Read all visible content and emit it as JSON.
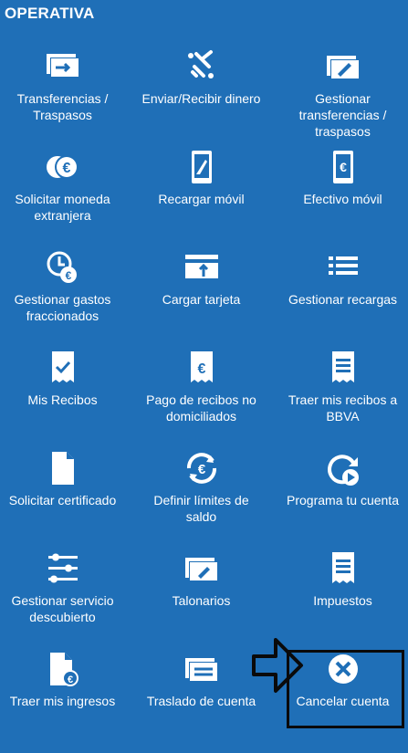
{
  "header": {
    "title": "OPERATIVA"
  },
  "colors": {
    "background": "#1f6fb7",
    "foreground": "#ffffff",
    "overlay": "#0a0a0a"
  },
  "tiles": [
    {
      "label_lines": [
        "Transferencias /",
        "Traspasos"
      ],
      "icon": "transfer-icon"
    },
    {
      "label_lines": [
        "Enviar/Recibir dinero"
      ],
      "icon": "send-receive-money-icon"
    },
    {
      "label_lines": [
        "Gestionar",
        "transferencias /",
        "traspasos"
      ],
      "icon": "manage-transfers-icon"
    },
    {
      "label_lines": [
        "Solicitar moneda",
        "extranjera"
      ],
      "icon": "foreign-currency-icon"
    },
    {
      "label_lines": [
        "Recargar móvil"
      ],
      "icon": "mobile-topup-icon"
    },
    {
      "label_lines": [
        "Efectivo móvil"
      ],
      "icon": "mobile-cash-icon"
    },
    {
      "label_lines": [
        "Gestionar gastos",
        "fraccionados"
      ],
      "icon": "split-payments-icon"
    },
    {
      "label_lines": [
        "Cargar tarjeta"
      ],
      "icon": "load-card-icon"
    },
    {
      "label_lines": [
        "Gestionar recargas"
      ],
      "icon": "manage-topups-icon"
    },
    {
      "label_lines": [
        "Mis Recibos"
      ],
      "icon": "receipts-icon"
    },
    {
      "label_lines": [
        "Pago de recibos no",
        "domiciliados"
      ],
      "icon": "receipt-payment-icon"
    },
    {
      "label_lines": [
        "Traer mis recibos a",
        "BBVA"
      ],
      "icon": "bring-receipts-icon"
    },
    {
      "label_lines": [
        "Solicitar certificado"
      ],
      "icon": "certificate-icon"
    },
    {
      "label_lines": [
        "Definir límites de",
        "saldo"
      ],
      "icon": "balance-limits-icon"
    },
    {
      "label_lines": [
        "Programa tu cuenta"
      ],
      "icon": "schedule-account-icon"
    },
    {
      "label_lines": [
        "Gestionar servicio",
        "descubierto"
      ],
      "icon": "overdraft-settings-icon"
    },
    {
      "label_lines": [
        "Talonarios"
      ],
      "icon": "checkbook-icon"
    },
    {
      "label_lines": [
        "Impuestos"
      ],
      "icon": "taxes-icon"
    },
    {
      "label_lines": [
        "Traer mis ingresos"
      ],
      "icon": "bring-income-icon"
    },
    {
      "label_lines": [
        "Traslado de cuenta"
      ],
      "icon": "account-transfer-icon"
    },
    {
      "label_lines": [
        "Cancelar cuenta"
      ],
      "icon": "close-circle-icon"
    }
  ]
}
